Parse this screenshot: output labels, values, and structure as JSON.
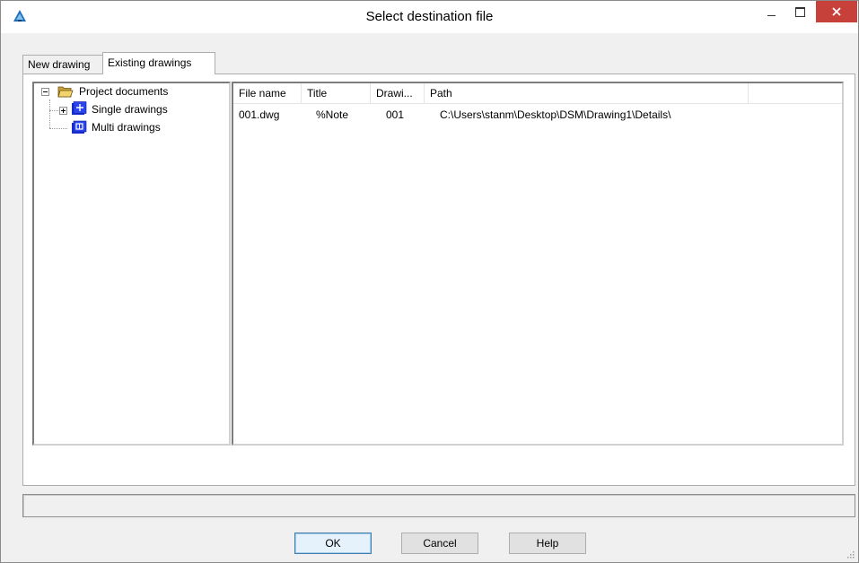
{
  "window": {
    "title": "Select destination file"
  },
  "tabs": [
    {
      "label": "New drawing",
      "active": false
    },
    {
      "label": "Existing drawings",
      "active": true
    }
  ],
  "tree": {
    "root": {
      "label": "Project documents",
      "icon": "open-folder-icon"
    },
    "children": [
      {
        "label": "Single drawings",
        "icon": "drawing-set-icon",
        "expandable": true
      },
      {
        "label": "Multi drawings",
        "icon": "multi-drawing-icon",
        "expandable": false
      }
    ]
  },
  "list": {
    "columns": [
      "File name",
      "Title",
      "Drawi...",
      "Path"
    ],
    "rows": [
      {
        "file": "001.dwg",
        "title": "%Note",
        "drawing": "001",
        "path": "C:\\Users\\stanm\\Desktop\\DSM\\Drawing1\\Details\\"
      }
    ]
  },
  "status": {
    "text": ""
  },
  "buttons": {
    "ok": "OK",
    "cancel": "Cancel",
    "help": "Help"
  },
  "colors": {
    "close_button": "#c7403a",
    "folder": "#e8c25a",
    "drawing_icon": "#1b2fd1"
  }
}
